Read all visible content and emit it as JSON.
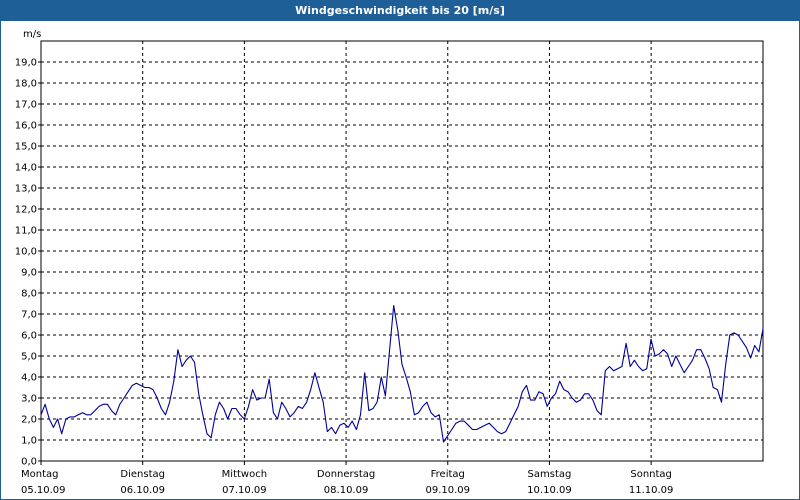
{
  "window": {
    "title": "Windgeschwindigkeit bis 20 [m/s]"
  },
  "colors": {
    "titlebar": "#1f5f98",
    "series": "#000099",
    "grid": "#000000"
  },
  "chart_data": {
    "type": "line",
    "title": "Windgeschwindigkeit bis 20 [m/s]",
    "unit": "m/s",
    "ylim": [
      0,
      20
    ],
    "y_ticks": [
      "0,0",
      "1,0",
      "2,0",
      "3,0",
      "4,0",
      "5,0",
      "6,0",
      "7,0",
      "8,0",
      "9,0",
      "10,0",
      "11,0",
      "12,0",
      "13,0",
      "14,0",
      "15,0",
      "16,0",
      "17,0",
      "18,0",
      "19,0"
    ],
    "grid": true,
    "grid_style": "dashed",
    "x_range_days": [
      0,
      7.1
    ],
    "x_labels": [
      {
        "day": "Montag",
        "date": "05.10.09"
      },
      {
        "day": "Dienstag",
        "date": "06.10.09"
      },
      {
        "day": "Mittwoch",
        "date": "07.10.09"
      },
      {
        "day": "Donnerstag",
        "date": "08.10.09"
      },
      {
        "day": "Freitag",
        "date": "09.10.09"
      },
      {
        "day": "Samstag",
        "date": "10.10.09"
      },
      {
        "day": "Sonntag",
        "date": "11.10.09"
      }
    ],
    "series": [
      {
        "values": [
          2.2,
          2.7,
          2.0,
          1.6,
          2.0,
          1.3,
          2.0,
          2.1,
          2.1,
          2.2,
          2.3,
          2.2,
          2.2,
          2.4,
          2.6,
          2.7,
          2.7,
          2.4,
          2.2,
          2.7,
          3.0,
          3.3,
          3.6,
          3.7,
          3.6,
          3.5,
          3.5,
          3.4,
          3.0,
          2.5,
          2.2,
          2.8,
          3.8,
          5.3,
          4.5,
          4.8,
          5.0,
          4.7,
          3.2,
          2.2,
          1.3,
          1.1,
          2.2,
          2.8,
          2.5,
          2.0,
          2.5,
          2.5,
          2.2,
          2.0,
          2.6,
          3.4,
          2.9,
          3.0,
          3.0,
          3.9,
          2.3,
          2.0,
          2.8,
          2.5,
          2.1,
          2.3,
          2.6,
          2.5,
          2.8,
          3.4,
          4.2,
          3.5,
          2.8,
          1.4,
          1.6,
          1.3,
          1.7,
          1.8,
          1.6,
          1.9,
          1.5,
          2.2,
          4.2,
          2.4,
          2.5,
          2.8,
          4.0,
          3.1,
          5.3,
          7.4,
          6.2,
          4.6,
          4.0,
          3.3,
          2.2,
          2.3,
          2.6,
          2.8,
          2.3,
          2.1,
          2.2,
          0.9,
          1.2,
          1.5,
          1.8,
          1.9,
          1.9,
          1.7,
          1.5,
          1.5,
          1.6,
          1.7,
          1.8,
          1.6,
          1.4,
          1.3,
          1.4,
          1.8,
          2.2,
          2.6,
          3.3,
          3.6,
          2.9,
          2.9,
          3.3,
          3.2,
          2.6,
          3.0,
          3.2,
          3.8,
          3.4,
          3.3,
          3.0,
          2.8,
          2.9,
          3.2,
          3.2,
          2.9,
          2.4,
          2.2,
          4.3,
          4.5,
          4.3,
          4.4,
          4.5,
          5.6,
          4.5,
          4.8,
          4.5,
          4.3,
          4.4,
          5.8,
          5.0,
          5.1,
          5.3,
          5.1,
          4.5,
          5.0,
          4.6,
          4.2,
          4.5,
          4.8,
          5.3,
          5.3,
          4.9,
          4.4,
          3.5,
          3.4,
          2.8,
          4.6,
          6.0,
          6.1,
          6.0,
          5.7,
          5.4,
          4.9,
          5.5,
          5.2,
          6.3
        ]
      }
    ]
  }
}
